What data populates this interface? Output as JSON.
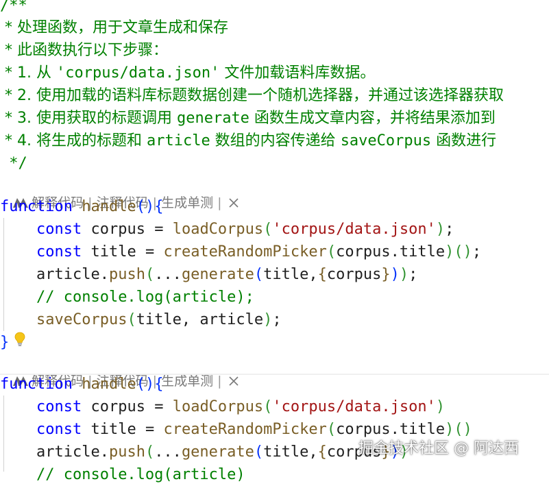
{
  "comment": {
    "open": "/**",
    "l1": " * 处理函数，用于文章生成和保存",
    "l2": " * 此函数执行以下步骤：",
    "l3_a": " * 1. 从 ",
    "l3_b": "'corpus/data.json'",
    "l3_c": " 文件加载语料库数据。",
    "l4": " * 2. 使用加载的语料库标题数据创建一个随机选择器，并通过该选择器获取",
    "l5_a": " * 3. 使用获取的标题调用 ",
    "l5_b": "generate",
    "l5_c": " 函数生成文章内容，并将结果添加到",
    "l6_a": " * 4. 将生成的标题和 ",
    "l6_b": "article",
    "l6_c": " 数组的内容传递给 ",
    "l6_d": "saveCorpus",
    "l6_e": " 函数进行",
    "close": " */"
  },
  "codelens": {
    "explain": "解释代码",
    "comment": "注释代码",
    "unittest": "生成单测",
    "sep": " | "
  },
  "code": {
    "kw_function": "function",
    "kw_const": "const",
    "fn_handle": "handle",
    "fn_loadCorpus": "loadCorpus",
    "fn_createRandomPicker": "createRandomPicker",
    "fn_push": "push",
    "fn_generate": "generate",
    "fn_saveCorpus": "saveCorpus",
    "var_corpus": "corpus",
    "var_title": "title",
    "var_article": "article",
    "str_path": "'corpus/data.json'",
    "line_comment": "// console.log(article);",
    "line_comment_partial": "// console.log(article)"
  },
  "watermark": "掘金技术社区 @ 阿达西"
}
